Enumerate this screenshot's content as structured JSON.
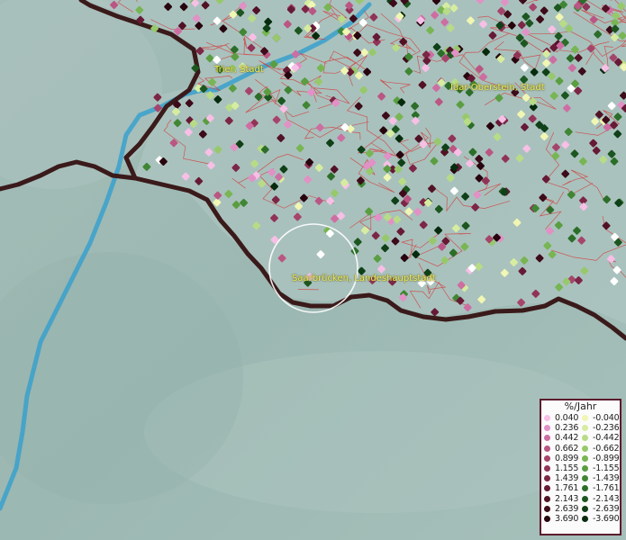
{
  "map": {
    "labels": {
      "trier": "Trier, Stadt",
      "idar": "Idar-Oberstein, Stadt",
      "saarbruecken": "Saarbrücken, Landeshauptstadt"
    },
    "colors": {
      "background": "#9fb9b4",
      "river": "#3aa0cc",
      "border": "#3a1a1a",
      "admin_lines": "#d23a3a",
      "highlight_circle": "#ffffff"
    }
  },
  "legend": {
    "title": "%/Jahr",
    "positive": [
      {
        "value": "0.040",
        "color": "#f7bfe6"
      },
      {
        "value": "0.236",
        "color": "#e191c5"
      },
      {
        "value": "0.442",
        "color": "#cd6ea2"
      },
      {
        "value": "0.662",
        "color": "#ba5683"
      },
      {
        "value": "0.899",
        "color": "#a6456c"
      },
      {
        "value": "1.155",
        "color": "#913357"
      },
      {
        "value": "1.439",
        "color": "#7c2645"
      },
      {
        "value": "1.761",
        "color": "#661a35"
      },
      {
        "value": "2.143",
        "color": "#521226"
      },
      {
        "value": "2.639",
        "color": "#3d0b1a"
      },
      {
        "value": "3.690",
        "color": "#27040e"
      }
    ],
    "negative": [
      {
        "value": "-0.040",
        "color": "#f0f6b3"
      },
      {
        "value": "-0.236",
        "color": "#d6eca0"
      },
      {
        "value": "-0.442",
        "color": "#b8dc86"
      },
      {
        "value": "-0.662",
        "color": "#97c96c"
      },
      {
        "value": "-0.899",
        "color": "#78b553"
      },
      {
        "value": "-1.155",
        "color": "#5a9e41"
      },
      {
        "value": "-1.439",
        "color": "#408634"
      },
      {
        "value": "-1.761",
        "color": "#2c6e29"
      },
      {
        "value": "-2.143",
        "color": "#1c5620"
      },
      {
        "value": "-2.639",
        "color": "#0f4017"
      },
      {
        "value": "-3.690",
        "color": "#062b0d"
      }
    ]
  }
}
